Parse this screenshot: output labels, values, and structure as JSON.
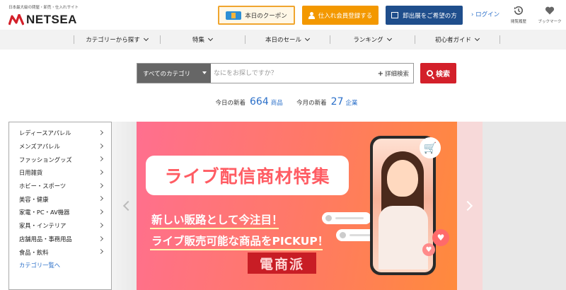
{
  "header": {
    "tagline": "日本最大級の問屋・卸売・仕入れサイト",
    "logo_text": "NETSEA",
    "coupon_label": "本日のクーポン",
    "member_label": "仕入れ会員登録する",
    "seller_label": "卸出展をご希望の方",
    "login_label": "ログイン",
    "history_label": "閲覧履歴",
    "bookmark_label": "ブックマーク",
    "brand_color": "#d3202a"
  },
  "nav": {
    "items": [
      {
        "label": "カテゴリーから探す"
      },
      {
        "label": "特集"
      },
      {
        "label": "本日のセール"
      },
      {
        "label": "ランキング"
      },
      {
        "label": "初心者ガイド"
      }
    ]
  },
  "search": {
    "category_value": "すべてのカテゴリ",
    "placeholder": "なにをお探しですか？",
    "advanced_label": "詳細検索",
    "button_label": "検索"
  },
  "stats": {
    "today_label": "今日の新着",
    "today_count": "664",
    "today_unit": "商品",
    "month_label": "今月の新着",
    "month_count": "27",
    "month_unit": "企業"
  },
  "categories": {
    "items": [
      {
        "label": "レディースアパレル"
      },
      {
        "label": "メンズアパレル"
      },
      {
        "label": "ファッショングッズ"
      },
      {
        "label": "日用雑貨"
      },
      {
        "label": "ホビー・スポーツ"
      },
      {
        "label": "美容・健康"
      },
      {
        "label": "家電・PC・AV機器"
      },
      {
        "label": "家具・インテリア"
      },
      {
        "label": "店舗用品・事務用品"
      },
      {
        "label": "食品・飲料"
      }
    ],
    "all_label": "カテゴリ一覧へ"
  },
  "banner": {
    "title": "ライブ配信商材特集",
    "line1": "新しい販路として今注目！",
    "line2": "ライブ販売可能な商品をPICKUP！",
    "stamp": "電商派"
  }
}
